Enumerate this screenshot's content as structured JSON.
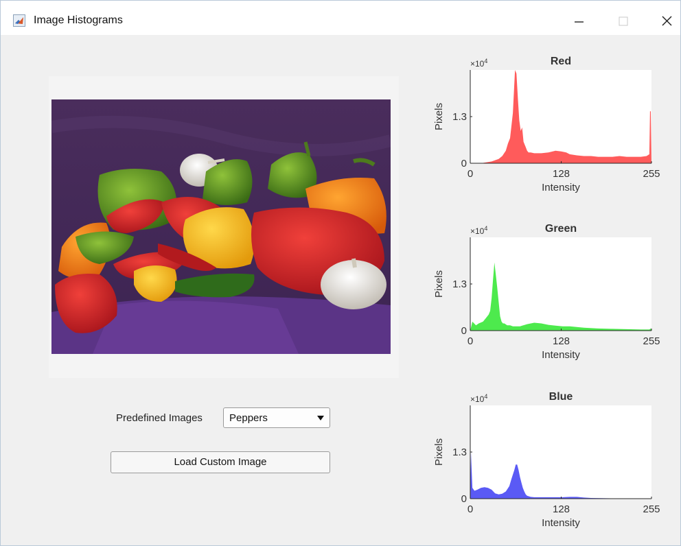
{
  "window": {
    "title": "Image Histograms"
  },
  "controls": {
    "predefined_label": "Predefined Images",
    "predefined_value": "Peppers",
    "load_button": "Load Custom Image"
  },
  "axes_common": {
    "exponent": "×10",
    "exponent_power": "4",
    "ylabel": "Pixels",
    "xlabel": "Intensity",
    "xticks": [
      "0",
      "128",
      "255"
    ],
    "yticks": [
      "0",
      "1.3"
    ]
  },
  "colors": {
    "red": "#ff5b5b",
    "green": "#4dea4d",
    "blue": "#5a5af5"
  },
  "chart_data": [
    {
      "type": "area",
      "title": "Red",
      "xlabel": "Intensity",
      "ylabel": "Pixels",
      "xlim": [
        0,
        255
      ],
      "ylim": [
        0,
        2.6
      ],
      "y_exponent": 4,
      "color": "#ff5b5b",
      "x": [
        0,
        15,
        30,
        40,
        45,
        50,
        53,
        56,
        60,
        63,
        65,
        67,
        69,
        71,
        73,
        75,
        78,
        80,
        82,
        85,
        90,
        100,
        110,
        120,
        128,
        135,
        140,
        150,
        160,
        170,
        180,
        190,
        200,
        210,
        220,
        230,
        240,
        248,
        252,
        253,
        254,
        255
      ],
      "y": [
        0,
        0,
        0.05,
        0.12,
        0.2,
        0.35,
        0.55,
        0.7,
        1.4,
        2.6,
        2.5,
        1.8,
        1.2,
        0.9,
        1.0,
        0.6,
        0.45,
        0.35,
        0.3,
        0.3,
        0.28,
        0.28,
        0.3,
        0.35,
        0.33,
        0.3,
        0.25,
        0.22,
        0.2,
        0.2,
        0.18,
        0.18,
        0.18,
        0.2,
        0.18,
        0.18,
        0.18,
        0.2,
        0.25,
        1.45,
        1.45,
        0
      ]
    },
    {
      "type": "area",
      "title": "Green",
      "xlabel": "Intensity",
      "ylabel": "Pixels",
      "xlim": [
        0,
        255
      ],
      "ylim": [
        0,
        2.6
      ],
      "y_exponent": 4,
      "color": "#4dea4d",
      "x": [
        0,
        3,
        8,
        12,
        18,
        22,
        26,
        28,
        30,
        32,
        34,
        36,
        38,
        40,
        42,
        44,
        46,
        48,
        52,
        56,
        60,
        70,
        80,
        90,
        100,
        110,
        120,
        130,
        140,
        150,
        160,
        180,
        200,
        220,
        240,
        252,
        254,
        255
      ],
      "y": [
        0,
        0.25,
        0.15,
        0.2,
        0.25,
        0.35,
        0.45,
        0.55,
        0.9,
        1.4,
        1.9,
        1.55,
        1.2,
        0.8,
        0.4,
        0.25,
        0.2,
        0.2,
        0.15,
        0.15,
        0.12,
        0.12,
        0.18,
        0.22,
        0.2,
        0.16,
        0.14,
        0.12,
        0.12,
        0.1,
        0.08,
        0.06,
        0.05,
        0.04,
        0.03,
        0.03,
        0.06,
        0
      ]
    },
    {
      "type": "area",
      "title": "Blue",
      "xlabel": "Intensity",
      "ylabel": "Pixels",
      "xlim": [
        0,
        255
      ],
      "ylim": [
        0,
        2.6
      ],
      "y_exponent": 4,
      "color": "#5a5af5",
      "x": [
        0,
        1,
        3,
        6,
        10,
        15,
        20,
        25,
        30,
        35,
        40,
        45,
        50,
        55,
        58,
        62,
        64,
        66,
        68,
        70,
        72,
        74,
        76,
        78,
        80,
        85,
        90,
        100,
        110,
        120,
        130,
        140,
        150,
        160,
        170,
        200,
        230,
        255
      ],
      "y": [
        0,
        1.3,
        0.3,
        0.22,
        0.25,
        0.3,
        0.32,
        0.3,
        0.25,
        0.15,
        0.12,
        0.14,
        0.2,
        0.35,
        0.55,
        0.8,
        0.95,
        0.95,
        0.8,
        0.6,
        0.45,
        0.3,
        0.2,
        0.12,
        0.08,
        0.05,
        0.04,
        0.04,
        0.04,
        0.04,
        0.04,
        0.05,
        0.05,
        0.03,
        0.02,
        0.01,
        0.01,
        0
      ]
    }
  ]
}
